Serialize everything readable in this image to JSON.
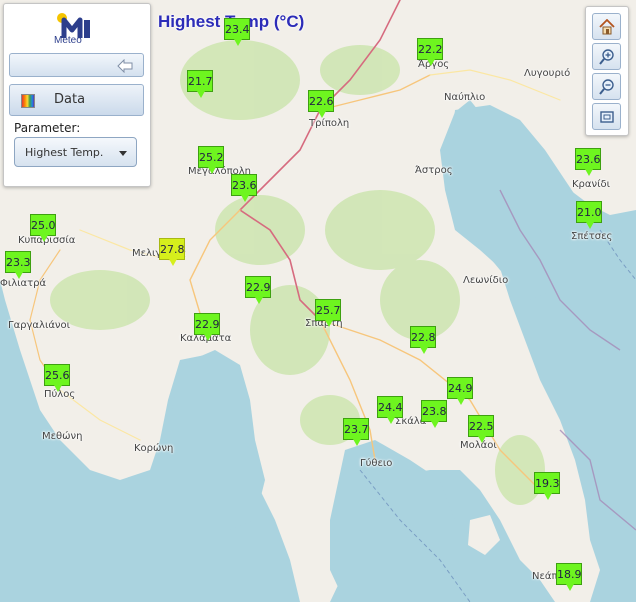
{
  "map_title": "Highest Temp (°C)",
  "logo": {
    "text": "Meteo"
  },
  "controls": {
    "data_label": "Data",
    "parameter_label": "Parameter:",
    "parameter_value": "Highest Temp."
  },
  "toolbar": [
    {
      "name": "home-icon"
    },
    {
      "name": "zoom-in-icon"
    },
    {
      "name": "zoom-out-icon"
    },
    {
      "name": "zoom-extent-icon"
    }
  ],
  "colors": {
    "marker_green": "#6ef51f",
    "marker_yellow": "#d6ef1c",
    "title_blue": "#2c2cb8",
    "sea": "#aad3df",
    "land": "#f2efe9"
  },
  "places": [
    {
      "name": "Άργος"
    },
    {
      "name": "Λυγουριό"
    },
    {
      "name": "Ναύπλιο"
    },
    {
      "name": "Τρίπολη"
    },
    {
      "name": "Μεγαλόπολη"
    },
    {
      "name": "Άστρος"
    },
    {
      "name": "Κρανίδι"
    },
    {
      "name": "Σπέτσες"
    },
    {
      "name": "Κυπαρισσία"
    },
    {
      "name": "Φιλιατρά"
    },
    {
      "name": "Μελιγαλάς"
    },
    {
      "name": "Λεωνίδιο"
    },
    {
      "name": "Γαργαλιάνοι"
    },
    {
      "name": "Καλαμάτα"
    },
    {
      "name": "Σπάρτη"
    },
    {
      "name": "Πύλος"
    },
    {
      "name": "Μεθώνη"
    },
    {
      "name": "Κορώνη"
    },
    {
      "name": "Σκάλα"
    },
    {
      "name": "Μολάοι"
    },
    {
      "name": "Γύθειο"
    },
    {
      "name": "Νεάπολη"
    }
  ],
  "stations": [
    {
      "value": "22.2"
    },
    {
      "value": "21.7"
    },
    {
      "value": "22.6"
    },
    {
      "value": "25.2"
    },
    {
      "value": "23.6"
    },
    {
      "value": "23.6"
    },
    {
      "value": "21.0"
    },
    {
      "value": "25.0"
    },
    {
      "value": "23.3"
    },
    {
      "value": "27.8"
    },
    {
      "value": "22.9"
    },
    {
      "value": "22.9"
    },
    {
      "value": "25.7"
    },
    {
      "value": "22.8"
    },
    {
      "value": "25.6"
    },
    {
      "value": "24.9"
    },
    {
      "value": "24.4"
    },
    {
      "value": "23.8"
    },
    {
      "value": "23.7"
    },
    {
      "value": "22.5"
    },
    {
      "value": "19.3"
    },
    {
      "value": "18.9"
    },
    {
      "value": "23.4"
    }
  ]
}
